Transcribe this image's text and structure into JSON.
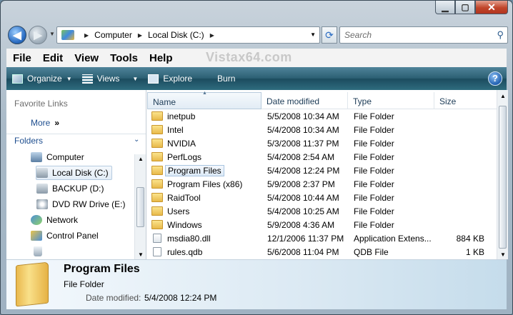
{
  "address": {
    "crumbs": [
      "Computer",
      "Local Disk (C:)"
    ]
  },
  "search": {
    "placeholder": "Search"
  },
  "menu": [
    "File",
    "Edit",
    "View",
    "Tools",
    "Help"
  ],
  "watermark": "Vistax64.com",
  "toolbar": {
    "organize": "Organize",
    "views": "Views",
    "explore": "Explore",
    "burn": "Burn",
    "help": "?"
  },
  "navpane": {
    "favorite_links": "Favorite Links",
    "more": "More",
    "folders": "Folders",
    "tree": [
      {
        "label": "Computer",
        "icon": "computer-icon"
      },
      {
        "label": "Local Disk (C:)",
        "icon": "hard-disk-icon",
        "selected": true
      },
      {
        "label": "BACKUP (D:)",
        "icon": "hard-disk-icon"
      },
      {
        "label": "DVD RW Drive (E:)",
        "icon": "dvd-drive-icon"
      },
      {
        "label": "Network",
        "icon": "network-icon"
      },
      {
        "label": "Control Panel",
        "icon": "control-panel-icon"
      },
      {
        "label": "",
        "icon": "recycle-bin-icon"
      }
    ]
  },
  "columns": {
    "name": "Name",
    "date": "Date modified",
    "type": "Type",
    "size": "Size"
  },
  "files": [
    {
      "name": "inetpub",
      "date": "5/5/2008 10:34 AM",
      "type": "File Folder",
      "size": "",
      "kind": "folder"
    },
    {
      "name": "Intel",
      "date": "5/4/2008 10:34 AM",
      "type": "File Folder",
      "size": "",
      "kind": "folder"
    },
    {
      "name": "NVIDIA",
      "date": "5/3/2008 11:37 PM",
      "type": "File Folder",
      "size": "",
      "kind": "folder"
    },
    {
      "name": "PerfLogs",
      "date": "5/4/2008 2:54 AM",
      "type": "File Folder",
      "size": "",
      "kind": "folder"
    },
    {
      "name": "Program Files",
      "date": "5/4/2008 12:24 PM",
      "type": "File Folder",
      "size": "",
      "kind": "folder",
      "selected": true
    },
    {
      "name": "Program Files (x86)",
      "date": "5/9/2008 2:37 PM",
      "type": "File Folder",
      "size": "",
      "kind": "folder"
    },
    {
      "name": "RaidTool",
      "date": "5/4/2008 10:44 AM",
      "type": "File Folder",
      "size": "",
      "kind": "folder"
    },
    {
      "name": "Users",
      "date": "5/4/2008 10:25 AM",
      "type": "File Folder",
      "size": "",
      "kind": "folder"
    },
    {
      "name": "Windows",
      "date": "5/9/2008 4:36 AM",
      "type": "File Folder",
      "size": "",
      "kind": "folder"
    },
    {
      "name": "msdia80.dll",
      "date": "12/1/2006 11:37 PM",
      "type": "Application Extens...",
      "size": "884 KB",
      "kind": "dll"
    },
    {
      "name": "rules.qdb",
      "date": "5/6/2008 11:04 PM",
      "type": "QDB File",
      "size": "1 KB",
      "kind": "file"
    }
  ],
  "details": {
    "title": "Program Files",
    "type": "File Folder",
    "date_label": "Date modified:",
    "date_value": "5/4/2008 12:24 PM"
  }
}
